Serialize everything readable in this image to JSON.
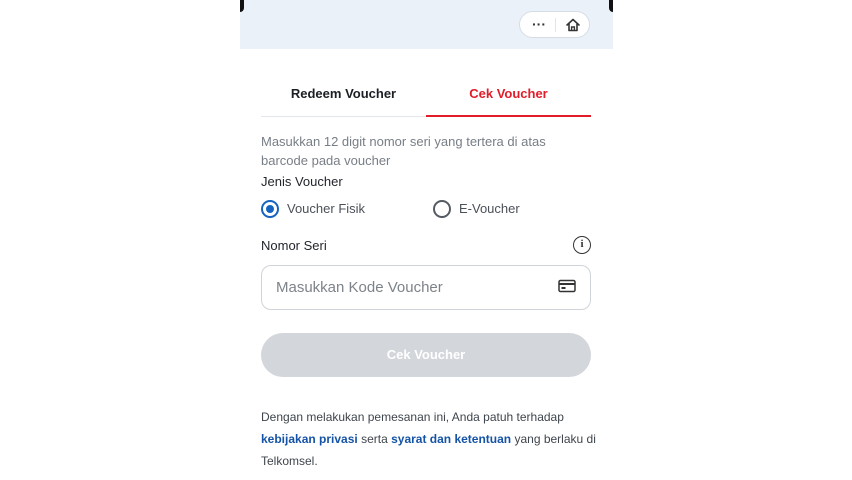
{
  "header": {
    "more_label": "···",
    "icons": {
      "more": "more-dots-icon",
      "home": "home-icon"
    }
  },
  "tabs": [
    {
      "label": "Redeem Voucher",
      "active": false
    },
    {
      "label": "Cek Voucher",
      "active": true
    }
  ],
  "form": {
    "description": "Masukkan 12 digit nomor seri yang tertera di atas barcode pada voucher",
    "voucher_type_label": "Jenis Voucher",
    "options": [
      {
        "label": "Voucher Fisik",
        "selected": true
      },
      {
        "label": "E-Voucher",
        "selected": false
      }
    ],
    "serial_label": "Nomor Seri",
    "serial_placeholder": "Masukkan Kode Voucher",
    "serial_value": "",
    "info_icon_glyph": "i",
    "submit_label": "Cek Voucher",
    "submit_enabled": false
  },
  "terms": {
    "prefix": "Dengan melakukan pemesanan ini, Anda patuh terhadap",
    "privacy_link": "kebijakan privasi",
    "and": " serta ",
    "tos_link": "syarat dan ketentuan",
    "suffix": " yang berlaku di Telkomsel."
  },
  "colors": {
    "accent_red": "#e11d2a",
    "link_blue": "#1553a6",
    "radio_blue": "#1565c0",
    "disabled_button": "#d3d6da",
    "header_bg": "#eaf1f9"
  }
}
